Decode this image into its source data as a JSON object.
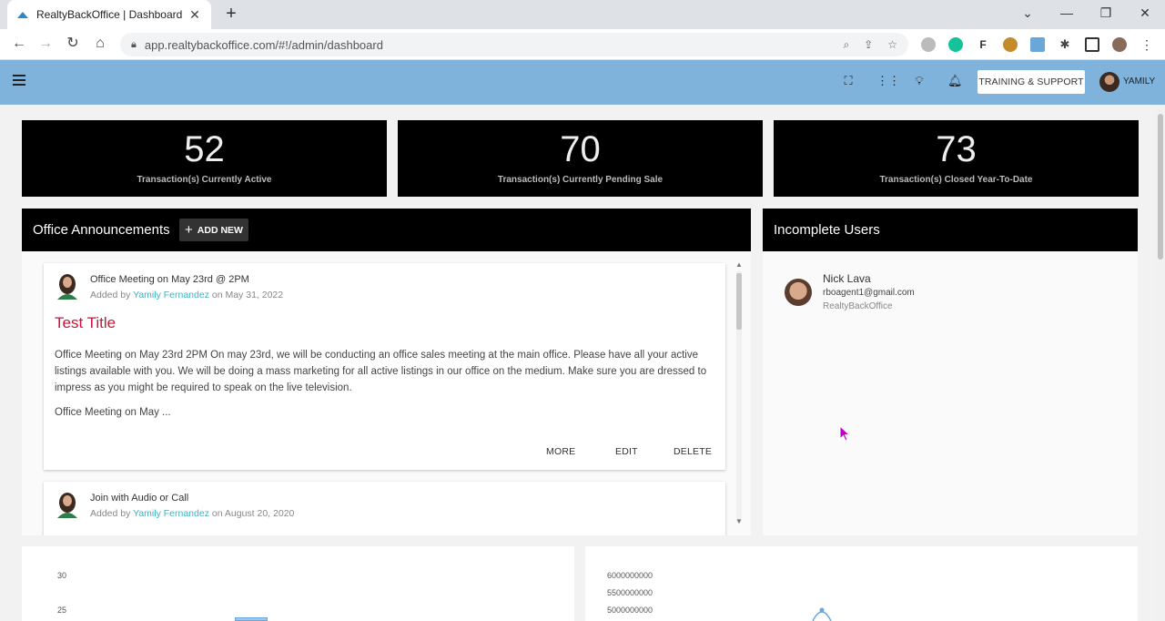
{
  "browser": {
    "tab_title": "RealtyBackOffice | Dashboard",
    "url": "app.realtybackoffice.com/#!/admin/dashboard",
    "tab_close": "✕",
    "new_tab": "+",
    "win_min": "—",
    "win_restore": "❐",
    "win_close": "✕",
    "win_down": "⌄"
  },
  "appbar": {
    "training_label": "TRAINING & SUPPORT",
    "user_name": "YAMILY"
  },
  "stats": [
    {
      "value": "52",
      "label": "Transaction(s) Currently Active"
    },
    {
      "value": "70",
      "label": "Transaction(s) Currently Pending Sale"
    },
    {
      "value": "73",
      "label": "Transaction(s) Closed Year-To-Date"
    }
  ],
  "announcements": {
    "title": "Office Announcements",
    "add_label": "ADD NEW",
    "items": [
      {
        "subject": "Office Meeting on May 23rd @ 2PM",
        "added_by_prefix": "Added by",
        "author": "Yamily Fernandez",
        "date_text": "on May 31, 2022",
        "title": "Test Title",
        "body": "Office Meeting on May 23rd 2PM On may 23rd, we will be conducting an office sales meeting at the main office. Please have all your active listings available with you. We will be doing a mass marketing for all active listings in our office on the medium. Make sure you are dressed to impress as you might be required to speak on the live television.",
        "excerpt": "Office Meeting on May ...",
        "actions": {
          "more": "MORE",
          "edit": "EDIT",
          "delete": "DELETE"
        }
      },
      {
        "subject": "Join with Audio or Call",
        "added_by_prefix": "Added by",
        "author": "Yamily Fernandez",
        "date_text": "on August 20, 2020"
      }
    ]
  },
  "incomplete_users": {
    "title": "Incomplete Users",
    "users": [
      {
        "name": "Nick Lava",
        "email": "rboagent1@gmail.com",
        "org": "RealtyBackOffice"
      }
    ]
  },
  "charts": {
    "left_ticks": [
      "30",
      "25"
    ],
    "right_ticks": [
      "6000000000",
      "5500000000",
      "5000000000"
    ]
  },
  "colors": {
    "appbar": "#7fb3dc",
    "card": "#000000",
    "accent_title": "#d0103a",
    "author_link": "#3db0c4"
  }
}
